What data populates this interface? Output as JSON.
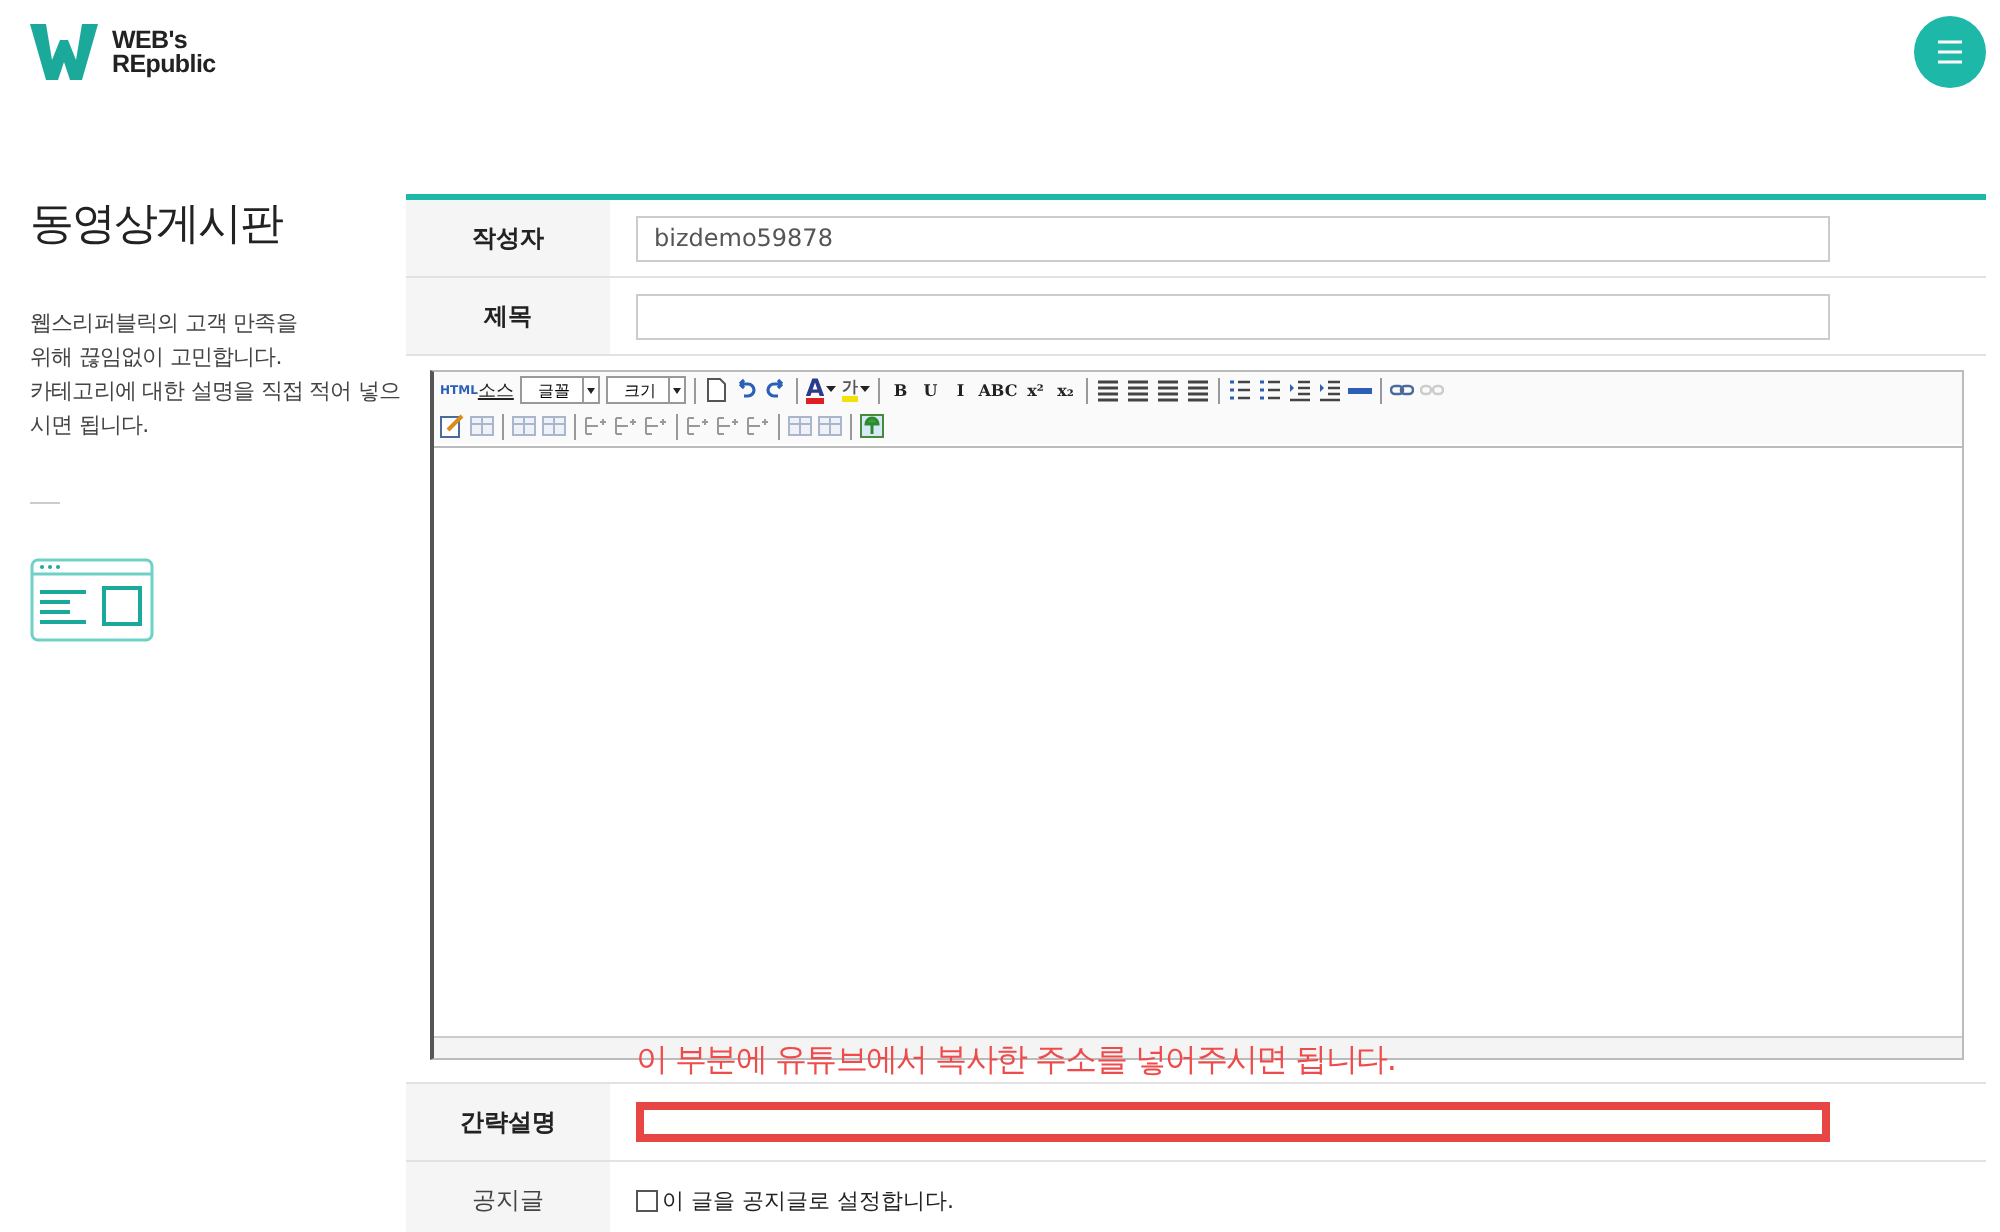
{
  "logo": {
    "line1": "WEB's",
    "line2": "REpublic"
  },
  "sidebar": {
    "title": "동영상게시판",
    "description_lines": [
      "웹스리퍼블릭의 고객 만족을",
      "위해 끊임없이 고민합니다.",
      "카테고리에 대한 설명을 직접 적어 넣으",
      "시면 됩니다."
    ]
  },
  "form": {
    "rows": [
      {
        "kind": "input",
        "label": "작성자",
        "value": "bizdemo59878"
      },
      {
        "kind": "input",
        "label": "제목"
      }
    ],
    "toolbar": [
      [
        {
          "kind": "source",
          "prefix": "HTML",
          "label": "소스"
        },
        {
          "kind": "select",
          "label": "글꼴"
        },
        {
          "kind": "select",
          "label": "크기"
        },
        {
          "kind": "sep"
        },
        {
          "kind": "doc"
        },
        {
          "kind": "undo"
        },
        {
          "kind": "redo"
        },
        {
          "kind": "sep"
        },
        {
          "kind": "forecolor",
          "label": "A"
        },
        {
          "kind": "highlight",
          "label": "가"
        },
        {
          "kind": "sep"
        },
        {
          "kind": "letter",
          "label": "B"
        },
        {
          "kind": "letter",
          "label": "U"
        },
        {
          "kind": "letter",
          "label": "I"
        },
        {
          "kind": "letter",
          "label": "ABC"
        },
        {
          "kind": "letter",
          "label": "x²"
        },
        {
          "kind": "letter",
          "label": "x₂"
        },
        {
          "kind": "sep"
        },
        {
          "kind": "align"
        },
        {
          "kind": "align"
        },
        {
          "kind": "align"
        },
        {
          "kind": "align"
        },
        {
          "kind": "sep"
        },
        {
          "kind": "list"
        },
        {
          "kind": "list"
        },
        {
          "kind": "indent"
        },
        {
          "kind": "indent"
        },
        {
          "kind": "rule"
        },
        {
          "kind": "sep"
        },
        {
          "kind": "link"
        },
        {
          "kind": "unlink"
        }
      ],
      [
        {
          "kind": "edit"
        },
        {
          "kind": "grid"
        },
        {
          "kind": "sep"
        },
        {
          "kind": "grid"
        },
        {
          "kind": "grid"
        },
        {
          "kind": "sep"
        },
        {
          "kind": "table"
        },
        {
          "kind": "table"
        },
        {
          "kind": "table"
        },
        {
          "kind": "sep"
        },
        {
          "kind": "table"
        },
        {
          "kind": "table"
        },
        {
          "kind": "table"
        },
        {
          "kind": "sep"
        },
        {
          "kind": "grid"
        },
        {
          "kind": "grid"
        },
        {
          "kind": "sep"
        },
        {
          "kind": "image"
        }
      ]
    ],
    "note": "이 부분에 유튜브에서 복사한 주소를 넣어주시면 됩니다.",
    "summary": {
      "label": "간략설명"
    },
    "notice": {
      "label": "공지글",
      "checked": false,
      "text": "이 글을 공지글로 설정합니다."
    }
  }
}
